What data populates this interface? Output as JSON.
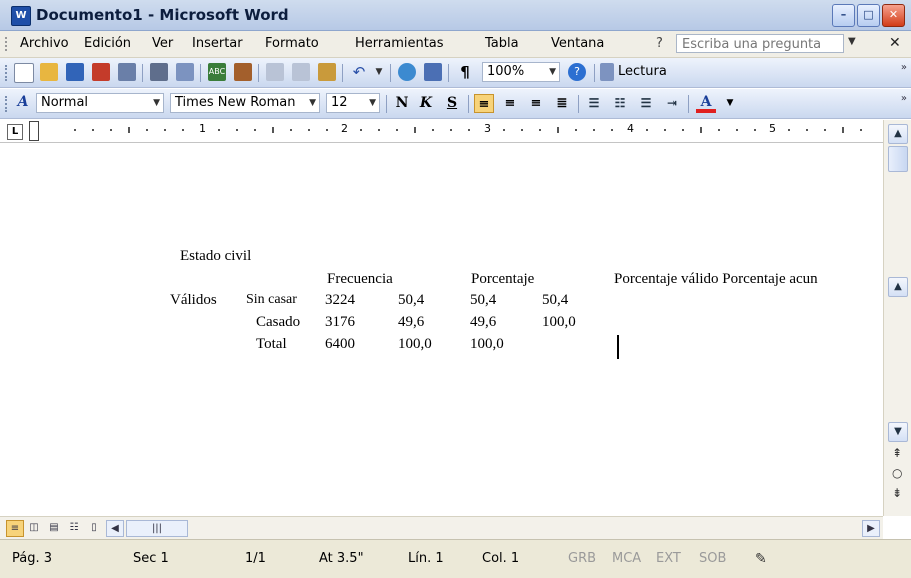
{
  "window": {
    "title": "Documento1 - Microsoft Word",
    "app_icon": "W"
  },
  "menu": {
    "items": [
      "Archivo",
      "Edición",
      "Ver",
      "Insertar",
      "Formato",
      "Herramientas",
      "Tabla",
      "Ventana"
    ],
    "help_mark": "?",
    "ask_placeholder": "Escriba una pregunta"
  },
  "toolbar_standard": {
    "zoom": "100%",
    "reading_label": "Lectura"
  },
  "toolbar_format": {
    "style": "Normal",
    "font": "Times New Roman",
    "size": "12",
    "bold": "N",
    "italic": "K",
    "underline": "S",
    "font_color_letter": "A"
  },
  "ruler": {
    "numbers": [
      "1",
      "2",
      "3",
      "4",
      "5"
    ]
  },
  "document": {
    "heading": "Estado civil",
    "columns": [
      "Frecuencia",
      "Porcentaje",
      "Porcentaje válido Porcentaje acun"
    ],
    "group_label": "Válidos",
    "rows": [
      {
        "label": "Sin casar",
        "freq": "3224",
        "pct": "50,4",
        "valid": "50,4",
        "cum": "50,4"
      },
      {
        "label": "Casado",
        "freq": "3176",
        "pct": "49,6",
        "valid": "49,6",
        "cum": "100,0"
      },
      {
        "label": "Total",
        "freq": "6400",
        "pct": "100,0",
        "valid": "100,0",
        "cum": ""
      }
    ]
  },
  "status": {
    "page": "Pág. 3",
    "section": "Sec 1",
    "pages": "1/1",
    "at": "At 3.5\"",
    "line": "Lín. 1",
    "col": "Col. 1",
    "grb": "GRB",
    "mca": "MCA",
    "ext": "EXT",
    "sob": "SOB"
  },
  "colors": {
    "accent": "#f7d37a",
    "toolbar": "#cad8ef",
    "menubar": "#f0eee6",
    "statusbar": "#ece9d8"
  }
}
